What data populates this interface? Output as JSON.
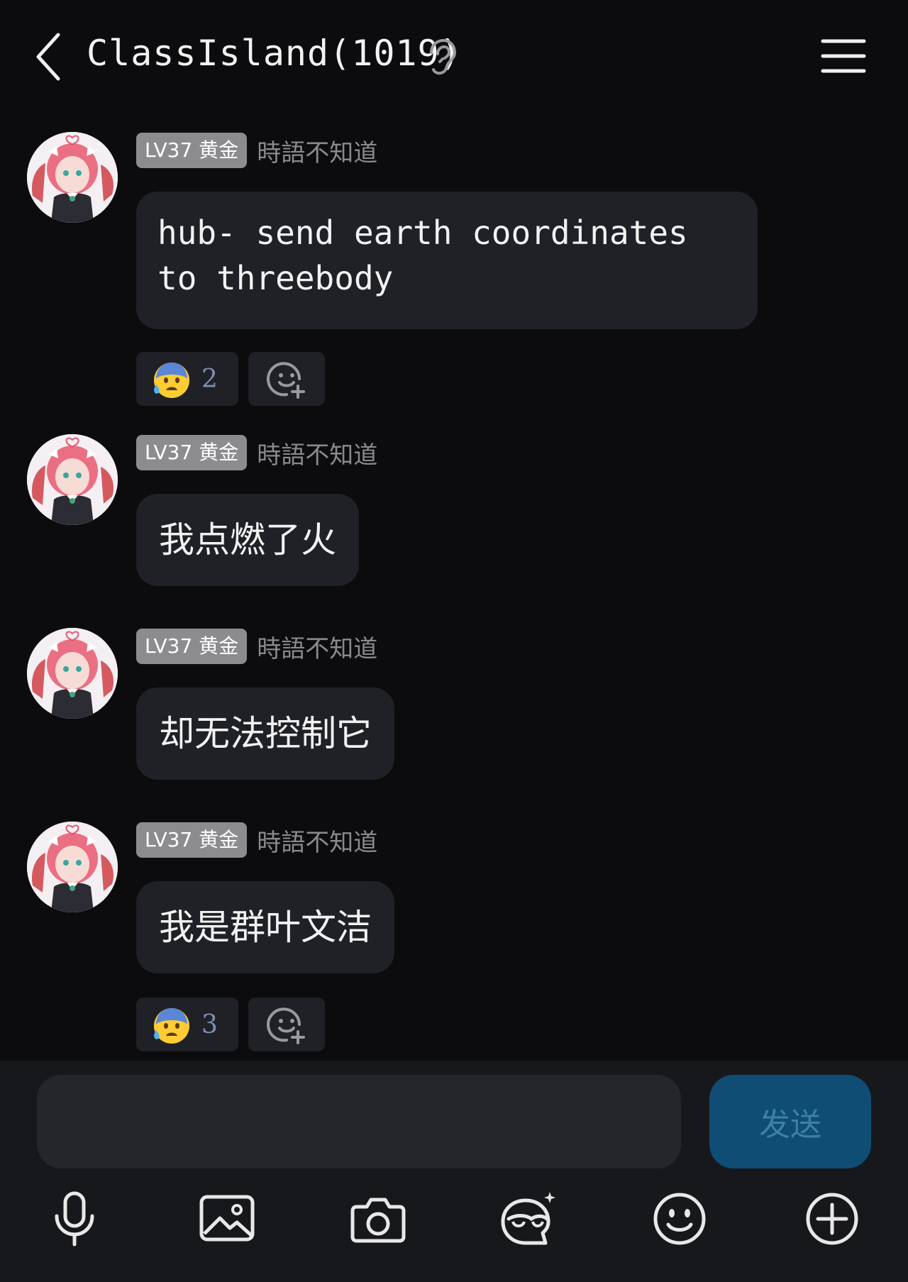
{
  "header": {
    "title": "ClassIsland(1019)",
    "back_icon": "chevron-left-icon",
    "ear_icon": "ear-icon",
    "menu_icon": "hamburger-menu-icon"
  },
  "messages": [
    {
      "level": "LV37 黄金",
      "sender": "時語不知道",
      "text": "hub- send earth coordinates to threebody",
      "reaction": {
        "emoji": "😰",
        "count": "2"
      }
    },
    {
      "level": "LV37 黄金",
      "sender": "時語不知道",
      "text": "我点燃了火"
    },
    {
      "level": "LV37 黄金",
      "sender": "時語不知道",
      "text": "却无法控制它"
    },
    {
      "level": "LV37 黄金",
      "sender": "時語不知道",
      "text": "我是群叶文洁",
      "reaction": {
        "emoji": "😰",
        "count": "3"
      }
    }
  ],
  "composer": {
    "placeholder": "",
    "value": "",
    "send_label": "发送"
  },
  "toolbar": [
    "microphone-icon",
    "image-icon",
    "camera-icon",
    "sticker-icon",
    "emoji-icon",
    "plus-icon"
  ],
  "colors": {
    "background": "#0c0c0e",
    "bubble": "#1f2126",
    "badge": "#8c8c90",
    "send_button": "#0f4d74",
    "send_text": "#3f7fa6",
    "reaction_count": "#7d8fb3"
  }
}
